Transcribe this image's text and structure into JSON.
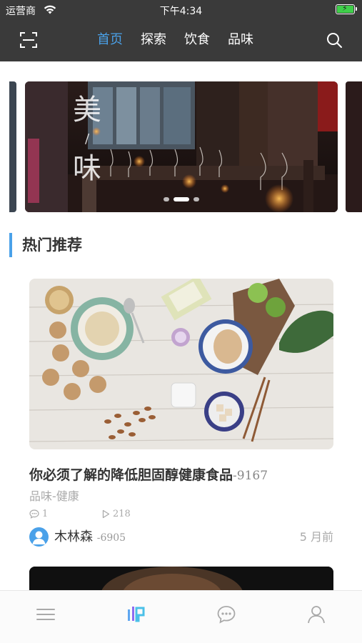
{
  "status_bar": {
    "carrier": "运营商",
    "time": "下午4:34",
    "wifi_icon": "wifi-icon",
    "battery_icon": "battery-charging-icon"
  },
  "header": {
    "scan_icon": "scan-icon",
    "search_icon": "search-icon",
    "tabs": [
      {
        "label": "首页",
        "active": true
      },
      {
        "label": "探索",
        "active": false
      },
      {
        "label": "饮食",
        "active": false
      },
      {
        "label": "品味",
        "active": false
      }
    ]
  },
  "banner": {
    "title_top": "美",
    "title_sep": "/",
    "title_bottom": "味",
    "slides": 3,
    "active_slide": 1
  },
  "section": {
    "title": "热门推荐"
  },
  "card": {
    "title": "你必须了解的降低胆固醇健康食品",
    "title_code": "-9167",
    "category": "品味-健康",
    "comments": "1",
    "plays": "218",
    "author_name": "木林森",
    "author_code": "-6905",
    "time_ago": "5 月前"
  },
  "tabbar": {
    "items": [
      {
        "icon": "menu-icon",
        "active": false
      },
      {
        "icon": "app-logo-icon",
        "active": true
      },
      {
        "icon": "chat-icon",
        "active": false
      },
      {
        "icon": "user-icon",
        "active": false
      }
    ]
  },
  "colors": {
    "accent": "#4aa1e9",
    "header_bg": "#3a3a3a",
    "muted_text": "#aaaaaa"
  }
}
